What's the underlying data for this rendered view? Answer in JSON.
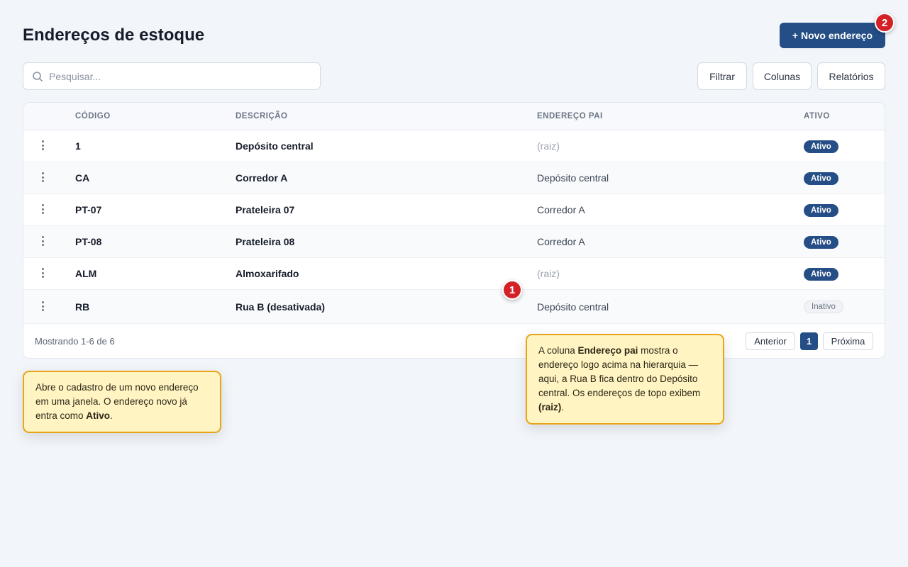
{
  "header": {
    "title": "Endereços de estoque",
    "new_button": "+ Novo endereço"
  },
  "search": {
    "placeholder": "Pesquisar...",
    "value": ""
  },
  "toolbar": {
    "filter": "Filtrar",
    "columns": "Colunas",
    "reports": "Relatórios"
  },
  "table": {
    "headers": {
      "code": "CÓDIGO",
      "description": "DESCRIÇÃO",
      "parent": "ENDEREÇO PAI",
      "active": "ATIVO"
    },
    "rows": [
      {
        "code": "1",
        "description": "Depósito central",
        "parent": "(raiz)",
        "status": "Ativo"
      },
      {
        "code": "CA",
        "description": "Corredor A",
        "parent": "Depósito central",
        "status": "Ativo"
      },
      {
        "code": "PT-07",
        "description": "Prateleira 07",
        "parent": "Corredor A",
        "status": "Ativo"
      },
      {
        "code": "PT-08",
        "description": "Prateleira 08",
        "parent": "Corredor A",
        "status": "Ativo"
      },
      {
        "code": "ALM",
        "description": "Almoxarifado",
        "parent": "(raiz)",
        "status": "Ativo"
      },
      {
        "code": "RB",
        "description": "Rua B (desativada)",
        "parent": "Depósito central",
        "status": "Inativo"
      }
    ]
  },
  "pagination": {
    "showing": "Mostrando 1-6 de 6",
    "prev": "Anterior",
    "current": "1",
    "next": "Próxima"
  },
  "markers": {
    "one": "1",
    "two": "2"
  },
  "tooltips": {
    "new_address": {
      "t1": "Abre o cadastro de um novo endereço em uma janela. O endereço novo já entra como ",
      "b1": "Ativo",
      "t2": "."
    },
    "parent_column": {
      "t1": "A coluna ",
      "b1": "Endereço pai",
      "t2": " mostra o endereço logo acima na hierarquia — aqui, a Rua B fica dentro do Depósito central. Os endereços de topo exibem ",
      "b2": "(raiz)",
      "t3": "."
    }
  },
  "colors": {
    "accent": "#244e85",
    "marker": "#d32127",
    "tooltip_bg": "#fff4c2",
    "tooltip_border": "#e8a51b"
  }
}
